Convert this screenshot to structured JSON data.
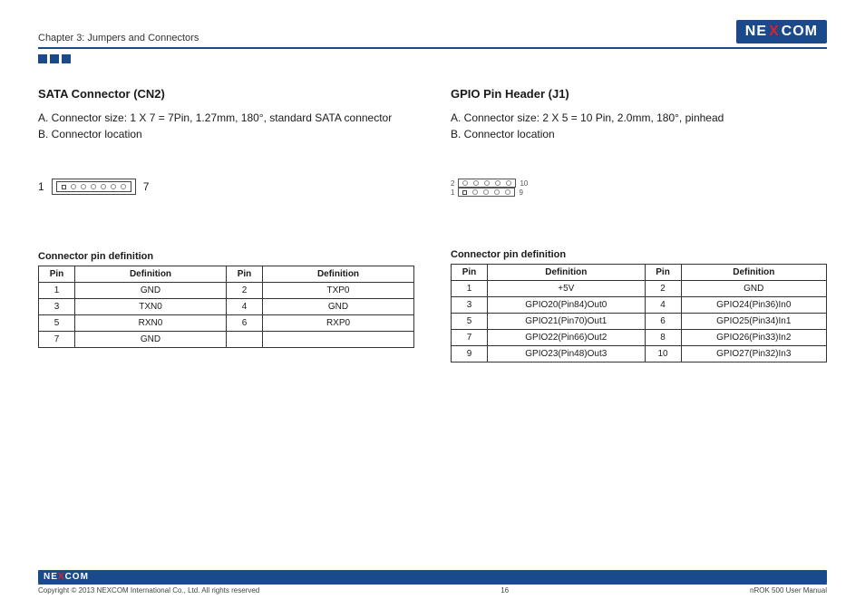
{
  "header": {
    "chapter": "Chapter 3: Jumpers and Connectors",
    "brand_pre": "NE",
    "brand_x": "X",
    "brand_post": "COM"
  },
  "left": {
    "title": "SATA Connector (CN2)",
    "lineA": "A. Connector size: 1 X 7 = 7Pin, 1.27mm, 180°, standard SATA connector",
    "lineB": "B. Connector location",
    "pin_start": "1",
    "pin_end": "7",
    "table_title": "Connector pin definition",
    "th": {
      "pin": "Pin",
      "def": "Definition"
    },
    "rows": [
      {
        "a": "1",
        "b": "GND",
        "c": "2",
        "d": "TXP0"
      },
      {
        "a": "3",
        "b": "TXN0",
        "c": "4",
        "d": "GND"
      },
      {
        "a": "5",
        "b": "RXN0",
        "c": "6",
        "d": "RXP0"
      },
      {
        "a": "7",
        "b": "GND",
        "c": "",
        "d": ""
      }
    ]
  },
  "right": {
    "title": "GPIO Pin Header (J1)",
    "lineA": "A. Connector size: 2 X 5 = 10 Pin, 2.0mm, 180°, pinhead",
    "lineB": "B. Connector location",
    "r1l": "2",
    "r1r": "10",
    "r2l": "1",
    "r2r": "9",
    "table_title": "Connector pin definition",
    "th": {
      "pin": "Pin",
      "def": "Definition"
    },
    "rows": [
      {
        "a": "1",
        "b": "+5V",
        "c": "2",
        "d": "GND"
      },
      {
        "a": "3",
        "b": "GPIO20(Pin84)Out0",
        "c": "4",
        "d": "GPIO24(Pin36)In0"
      },
      {
        "a": "5",
        "b": "GPIO21(Pin70)Out1",
        "c": "6",
        "d": "GPIO25(Pin34)In1"
      },
      {
        "a": "7",
        "b": "GPIO22(Pin66)Out2",
        "c": "8",
        "d": "GPIO26(Pin33)In2"
      },
      {
        "a": "9",
        "b": "GPIO23(Pin48)Out3",
        "c": "10",
        "d": "GPIO27(Pin32)In3"
      }
    ]
  },
  "footer": {
    "copyright": "Copyright © 2013 NEXCOM International Co., Ltd. All rights reserved",
    "page": "16",
    "manual": "nROK 500 User Manual",
    "brand_pre": "NE",
    "brand_x": "X",
    "brand_post": "COM"
  },
  "chart_data": [
    {
      "type": "table",
      "title": "SATA Connector (CN2) pin definition",
      "columns": [
        "Pin",
        "Definition"
      ],
      "rows": [
        [
          1,
          "GND"
        ],
        [
          2,
          "TXP0"
        ],
        [
          3,
          "TXN0"
        ],
        [
          4,
          "GND"
        ],
        [
          5,
          "RXN0"
        ],
        [
          6,
          "RXP0"
        ],
        [
          7,
          "GND"
        ]
      ]
    },
    {
      "type": "table",
      "title": "GPIO Pin Header (J1) pin definition",
      "columns": [
        "Pin",
        "Definition"
      ],
      "rows": [
        [
          1,
          "+5V"
        ],
        [
          2,
          "GND"
        ],
        [
          3,
          "GPIO20(Pin84)Out0"
        ],
        [
          4,
          "GPIO24(Pin36)In0"
        ],
        [
          5,
          "GPIO21(Pin70)Out1"
        ],
        [
          6,
          "GPIO25(Pin34)In1"
        ],
        [
          7,
          "GPIO22(Pin66)Out2"
        ],
        [
          8,
          "GPIO26(Pin33)In2"
        ],
        [
          9,
          "GPIO23(Pin48)Out3"
        ],
        [
          10,
          "GPIO27(Pin32)In3"
        ]
      ]
    }
  ]
}
